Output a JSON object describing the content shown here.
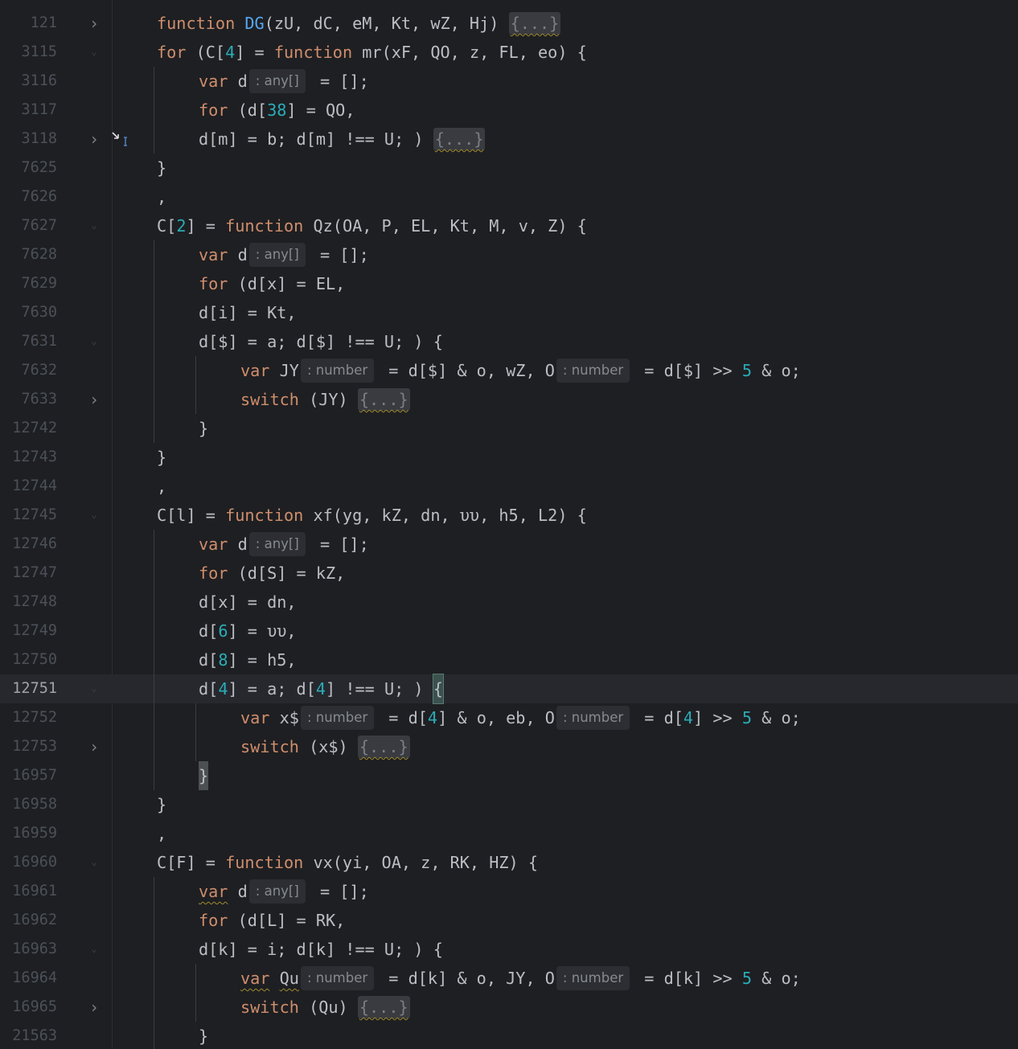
{
  "editor": {
    "current_line": "12751",
    "colors": {
      "background": "#1e1f22",
      "keyword": "#cf8e6d",
      "function_name": "#56a8f5",
      "number": "#2aacb8",
      "text": "#bcbec4",
      "line_number": "#4b5059"
    },
    "lines": [
      {
        "ln": "121",
        "fold": "collapsed",
        "indent": 1,
        "tokens": [
          {
            "t": "function",
            "c": "kw"
          },
          {
            "t": " "
          },
          {
            "t": "DG",
            "c": "fn"
          },
          {
            "t": "(zU, dC, eM, Kt, wZ, Hj) "
          },
          {
            "t": "{...}",
            "c": "chip"
          }
        ]
      },
      {
        "ln": "3115",
        "fold": "expanded",
        "indent": 1,
        "tokens": [
          {
            "t": "for",
            "c": "kw"
          },
          {
            "t": " (C["
          },
          {
            "t": "4",
            "c": "num"
          },
          {
            "t": "] = "
          },
          {
            "t": "function",
            "c": "kw"
          },
          {
            "t": " mr(xF, QO, z, FL, eo) {"
          }
        ]
      },
      {
        "ln": "3116",
        "fold": "",
        "indent": 2,
        "tokens": [
          {
            "t": "var",
            "c": "kw"
          },
          {
            "t": " d"
          },
          {
            "t": ": any[]",
            "c": "hint"
          },
          {
            "t": " = [];"
          }
        ]
      },
      {
        "ln": "3117",
        "fold": "",
        "indent": 2,
        "tokens": [
          {
            "t": "for",
            "c": "kw"
          },
          {
            "t": " (d["
          },
          {
            "t": "38",
            "c": "num"
          },
          {
            "t": "] = QO,"
          }
        ]
      },
      {
        "ln": "3118",
        "fold": "collapsed",
        "indent": 2,
        "tokens": [
          {
            "t": "d[m] = b; d[m] !== U; ) "
          },
          {
            "t": "{...}",
            "c": "chip"
          }
        ]
      },
      {
        "ln": "7625",
        "fold": "",
        "indent": 1,
        "tokens": [
          {
            "t": "}"
          }
        ]
      },
      {
        "ln": "7626",
        "fold": "",
        "indent": 1,
        "tokens": [
          {
            "t": ","
          }
        ]
      },
      {
        "ln": "7627",
        "fold": "expanded",
        "indent": 1,
        "tokens": [
          {
            "t": "C["
          },
          {
            "t": "2",
            "c": "num"
          },
          {
            "t": "] = "
          },
          {
            "t": "function",
            "c": "kw"
          },
          {
            "t": " Qz(OA, P, EL, Kt, M, v, Z) {"
          }
        ]
      },
      {
        "ln": "7628",
        "fold": "",
        "indent": 2,
        "tokens": [
          {
            "t": "var",
            "c": "kw"
          },
          {
            "t": " d"
          },
          {
            "t": ": any[]",
            "c": "hint"
          },
          {
            "t": " = [];"
          }
        ]
      },
      {
        "ln": "7629",
        "fold": "",
        "indent": 2,
        "tokens": [
          {
            "t": "for",
            "c": "kw"
          },
          {
            "t": " (d[x] = EL,"
          }
        ]
      },
      {
        "ln": "7630",
        "fold": "",
        "indent": 2,
        "tokens": [
          {
            "t": "d[i] = Kt,"
          }
        ]
      },
      {
        "ln": "7631",
        "fold": "expanded",
        "indent": 2,
        "tokens": [
          {
            "t": "d[$] = a; d[$] !== U; ) {"
          }
        ]
      },
      {
        "ln": "7632",
        "fold": "",
        "indent": 3,
        "tokens": [
          {
            "t": "var",
            "c": "kw"
          },
          {
            "t": " JY"
          },
          {
            "t": ": number",
            "c": "hint"
          },
          {
            "t": " = d[$] & o, wZ, O"
          },
          {
            "t": ": number",
            "c": "hint"
          },
          {
            "t": " = d[$] >> "
          },
          {
            "t": "5",
            "c": "num"
          },
          {
            "t": " & o;"
          }
        ]
      },
      {
        "ln": "7633",
        "fold": "collapsed",
        "indent": 3,
        "tokens": [
          {
            "t": "switch",
            "c": "kw"
          },
          {
            "t": " (JY) "
          },
          {
            "t": "{...}",
            "c": "chip"
          }
        ]
      },
      {
        "ln": "12742",
        "fold": "",
        "indent": 2,
        "tokens": [
          {
            "t": "}"
          }
        ]
      },
      {
        "ln": "12743",
        "fold": "",
        "indent": 1,
        "tokens": [
          {
            "t": "}"
          }
        ]
      },
      {
        "ln": "12744",
        "fold": "",
        "indent": 1,
        "tokens": [
          {
            "t": ","
          }
        ]
      },
      {
        "ln": "12745",
        "fold": "expanded",
        "indent": 1,
        "tokens": [
          {
            "t": "C[l] = "
          },
          {
            "t": "function",
            "c": "kw"
          },
          {
            "t": " xf(yg, kZ, dn, υυ, h5, L2) {"
          }
        ]
      },
      {
        "ln": "12746",
        "fold": "",
        "indent": 2,
        "tokens": [
          {
            "t": "var",
            "c": "kw"
          },
          {
            "t": " d"
          },
          {
            "t": ": any[]",
            "c": "hint"
          },
          {
            "t": " = [];"
          }
        ]
      },
      {
        "ln": "12747",
        "fold": "",
        "indent": 2,
        "tokens": [
          {
            "t": "for",
            "c": "kw"
          },
          {
            "t": " (d[S] = kZ,"
          }
        ]
      },
      {
        "ln": "12748",
        "fold": "",
        "indent": 2,
        "tokens": [
          {
            "t": "d[x] = dn,"
          }
        ]
      },
      {
        "ln": "12749",
        "fold": "",
        "indent": 2,
        "tokens": [
          {
            "t": "d["
          },
          {
            "t": "6",
            "c": "num"
          },
          {
            "t": "] = υυ,"
          }
        ]
      },
      {
        "ln": "12750",
        "fold": "",
        "indent": 2,
        "tokens": [
          {
            "t": "d["
          },
          {
            "t": "8",
            "c": "num"
          },
          {
            "t": "] = h5,"
          }
        ]
      },
      {
        "ln": "12751",
        "fold": "expanded",
        "indent": 2,
        "current": true,
        "tokens": [
          {
            "t": "d["
          },
          {
            "t": "4",
            "c": "num"
          },
          {
            "t": "] = a; d["
          },
          {
            "t": "4",
            "c": "num"
          },
          {
            "t": "] !== U; ) "
          },
          {
            "t": "",
            "c": "caret"
          },
          {
            "t": "{",
            "c": "bracket"
          }
        ]
      },
      {
        "ln": "12752",
        "fold": "",
        "indent": 3,
        "tokens": [
          {
            "t": "var",
            "c": "kw"
          },
          {
            "t": " x$"
          },
          {
            "t": ": number",
            "c": "hint"
          },
          {
            "t": " = d["
          },
          {
            "t": "4",
            "c": "num"
          },
          {
            "t": "] & o, eb, O"
          },
          {
            "t": ": number",
            "c": "hint"
          },
          {
            "t": " = d["
          },
          {
            "t": "4",
            "c": "num"
          },
          {
            "t": "] >> "
          },
          {
            "t": "5",
            "c": "num"
          },
          {
            "t": " & o;"
          }
        ]
      },
      {
        "ln": "12753",
        "fold": "collapsed",
        "indent": 3,
        "tokens": [
          {
            "t": "switch",
            "c": "kw"
          },
          {
            "t": " (x$) "
          },
          {
            "t": "{...}",
            "c": "chip"
          }
        ]
      },
      {
        "ln": "16957",
        "fold": "",
        "indent": 2,
        "tokens": [
          {
            "t": "}",
            "c": "bracketclose"
          }
        ]
      },
      {
        "ln": "16958",
        "fold": "",
        "indent": 1,
        "tokens": [
          {
            "t": "}"
          }
        ]
      },
      {
        "ln": "16959",
        "fold": "",
        "indent": 1,
        "tokens": [
          {
            "t": ","
          }
        ]
      },
      {
        "ln": "16960",
        "fold": "expanded",
        "indent": 1,
        "tokens": [
          {
            "t": "C[F] = "
          },
          {
            "t": "function",
            "c": "kw"
          },
          {
            "t": " vx(yi, OA, z, RK, HZ) {"
          }
        ]
      },
      {
        "ln": "16961",
        "fold": "",
        "indent": 2,
        "tokens": [
          {
            "t": "var",
            "c": "kwwarn"
          },
          {
            "t": " d"
          },
          {
            "t": ": any[]",
            "c": "hint"
          },
          {
            "t": " = [];"
          }
        ]
      },
      {
        "ln": "16962",
        "fold": "",
        "indent": 2,
        "tokens": [
          {
            "t": "for",
            "c": "kw"
          },
          {
            "t": " (d[L] = RK,"
          }
        ]
      },
      {
        "ln": "16963",
        "fold": "expanded",
        "indent": 2,
        "tokens": [
          {
            "t": "d[k] = i; d[k] !== U; ) {"
          }
        ]
      },
      {
        "ln": "16964",
        "fold": "",
        "indent": 3,
        "tokens": [
          {
            "t": "var",
            "c": "kwwarn"
          },
          {
            "t": " "
          },
          {
            "t": "Qu",
            "c": "warn"
          },
          {
            "t": ": number",
            "c": "hint"
          },
          {
            "t": " = d[k] & o, JY, O"
          },
          {
            "t": ": number",
            "c": "hint"
          },
          {
            "t": " = d[k] >> "
          },
          {
            "t": "5",
            "c": "num"
          },
          {
            "t": " & o;"
          }
        ]
      },
      {
        "ln": "16965",
        "fold": "collapsed",
        "indent": 3,
        "tokens": [
          {
            "t": "switch",
            "c": "kw"
          },
          {
            "t": " (Qu) "
          },
          {
            "t": "{...}",
            "c": "chip"
          }
        ]
      },
      {
        "ln": "21563",
        "fold": "",
        "indent": 2,
        "tokens": [
          {
            "t": "}"
          }
        ]
      }
    ]
  }
}
